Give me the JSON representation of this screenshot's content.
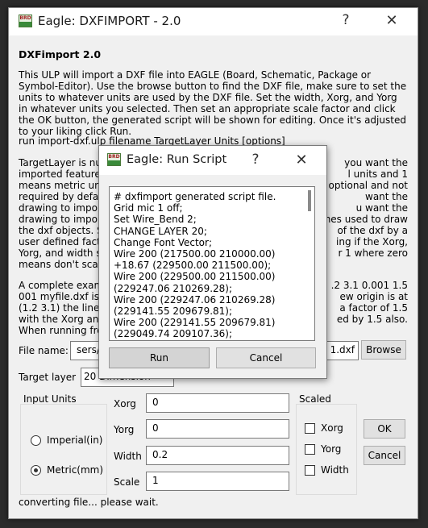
{
  "main_window": {
    "title": "Eagle: DXFIMPORT - 2.0",
    "icon_text": "BRD",
    "help_label": "?",
    "close_label": "✕",
    "heading": "DXFimport 2.0",
    "description": "This ULP will import a DXF file into EAGLE (Board, Schematic, Package or Symbol-Editor). Use the browse button to find the DXF file, make sure to set the units to whatever units are used by the DXF file. Set the width, Xorg, and Yorg in whatever units you selected. Then set an appropriate scale factor and click the OK button, the generated script will be shown for editing. Once it's adjusted to your liking click Run.",
    "usage": "run import-dxf.ulp filename TargetLayer Units [options]",
    "target_layer_para": [
      {
        "left": "TargetLayer is num",
        "right": "you want the"
      },
      {
        "left": "imported features",
        "right": "l units and 1"
      },
      {
        "left": "means metric unit",
        "right": "e optional and not"
      },
      {
        "left": "required by defau",
        "right": "want the"
      },
      {
        "left": "drawing to import",
        "right": "u want the"
      },
      {
        "left": "drawing to import",
        "right": "nes used to draw"
      },
      {
        "left": "the dxf objects. S",
        "right": "of the dxf by a"
      },
      {
        "left": "user defined facto",
        "right": "ing if the Xorg,"
      },
      {
        "left": "Yorg, and width s",
        "right": "r 1 where zero"
      },
      {
        "left": "means don't scale",
        "right": ""
      }
    ],
    "example_para": [
      {
        "left": "A complete examp",
        "right": ".2 3.1 0.001 1.5"
      },
      {
        "left": "001 myfile.dxf is b",
        "right": "ew origin is at"
      },
      {
        "left": "(1.2 3.1) the linew",
        "right": "a factor of 1.5"
      },
      {
        "left": "with the Xorg and",
        "right": "ed by 1.5 also."
      },
      {
        "left": "When running fro",
        "right": ""
      }
    ],
    "file_name_label": "File name:",
    "file_name_left": "sers/l",
    "file_name_right": "1.dxf",
    "browse_label": "Browse",
    "target_layer_label": "Target layer",
    "target_layer_value": "20 Dimension",
    "input_units": {
      "title": "Input Units",
      "options": [
        "Imperial(in)",
        "Metric(mm)"
      ],
      "selected": "Metric(mm)"
    },
    "fields": {
      "xorg_label": "Xorg",
      "xorg_value": "0",
      "yorg_label": "Yorg",
      "yorg_value": "0",
      "width_label": "Width",
      "width_value": "0.2",
      "scale_label": "Scale",
      "scale_value": "1"
    },
    "scaled": {
      "title": "Scaled",
      "options": [
        "Xorg",
        "Yorg",
        "Width"
      ]
    },
    "ok_label": "OK",
    "cancel_label": "Cancel",
    "status": "converting file... please wait."
  },
  "run_script_dialog": {
    "title": "Eagle: Run Script",
    "icon_text": "BRD",
    "help_label": "?",
    "close_label": "✕",
    "script_lines": [
      "# dxfimport generated script file.",
      "Grid mic 1 off;",
      "Set Wire_Bend 2;",
      "CHANGE LAYER 20;",
      "Change Font Vector;",
      "Wire 200 (217500.00 210000.00)",
      "+18.67 (229500.00 211500.00);",
      "Wire 200 (229500.00 211500.00)",
      "(229247.06 210269.28);",
      "Wire 200 (229247.06 210269.28)",
      "(229141.55 209679.81);",
      "Wire 200 (229141.55 209679.81)",
      "(229049.74 209107.36);"
    ],
    "run_label": "Run",
    "cancel_label": "Cancel"
  }
}
